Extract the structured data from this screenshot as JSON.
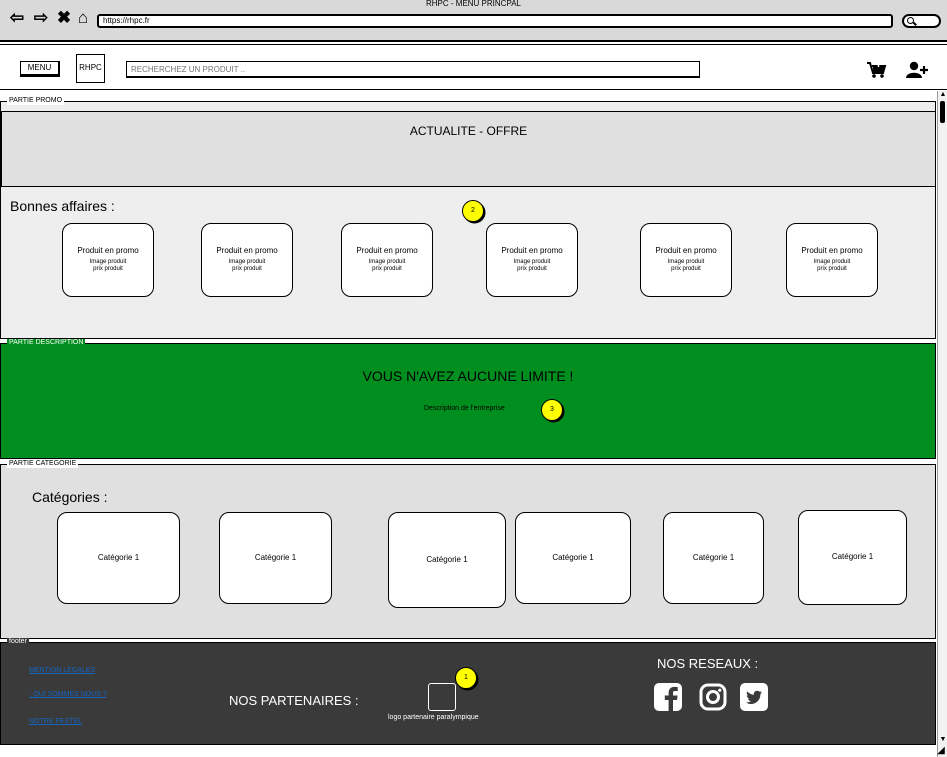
{
  "browser": {
    "window_title": "RHPC - MENU PRINCPAL",
    "url": "https://rhpc.fr",
    "nav_icons": [
      "arrow-left-icon",
      "arrow-right-icon",
      "close-icon",
      "home-icon"
    ]
  },
  "header": {
    "menu_label": "MENU",
    "logo_label": "RHPC",
    "search_placeholder": "RECHERCHEZ UN PRODUIT ..",
    "icons": [
      "cart-add-icon",
      "user-add-icon"
    ]
  },
  "promo": {
    "section_label": "PARTIE PROMO",
    "banner_title": "ACTUALITE - OFFRE",
    "heading": "Bonnes affaires :",
    "cards": [
      {
        "title": "Produit en promo",
        "image": "Image produit",
        "price": "prix produit"
      },
      {
        "title": "Produit en promo",
        "image": "Image produit",
        "price": "prix produit"
      },
      {
        "title": "Produit en promo",
        "image": "Image produit",
        "price": "prix produit"
      },
      {
        "title": "Produit en promo",
        "image": "Image produit",
        "price": "prix produit"
      },
      {
        "title": "Produit en promo",
        "image": "Image produit",
        "price": "prix produit"
      },
      {
        "title": "Produit en promo",
        "image": "Image produit",
        "price": "prix produit"
      }
    ]
  },
  "description": {
    "section_label": "PARTIE DESCRIPTION",
    "title": "VOUS N'AVEZ AUCUNE LIMITE !",
    "text": "Description de l'entreprise",
    "background_color": "#008f1e"
  },
  "category": {
    "section_label": "PARTIE CATEGORIE",
    "heading": "Catégories :",
    "cards": [
      "Catégorie 1",
      "Catégorie 1",
      "Catégorie 1",
      "Catégorie 1",
      "Catégorie 1",
      "Catégorie 1"
    ]
  },
  "footer": {
    "section_label": "footer",
    "links": [
      "MENTION LEGALES",
      "- QUI SOMMES NOUS ?",
      "NOTRE FESTEL"
    ],
    "partners_title": "NOS PARTENAIRES :",
    "partner_caption": "logo partenaire paralympique",
    "social_title": "NOS RESEAUX :",
    "social_icons": [
      "facebook-icon",
      "instagram-icon",
      "twitter-icon"
    ],
    "background_color": "#3a3a3a"
  },
  "annotations": {
    "badges": [
      "1",
      "2",
      "3"
    ],
    "color": "#ffff00"
  }
}
